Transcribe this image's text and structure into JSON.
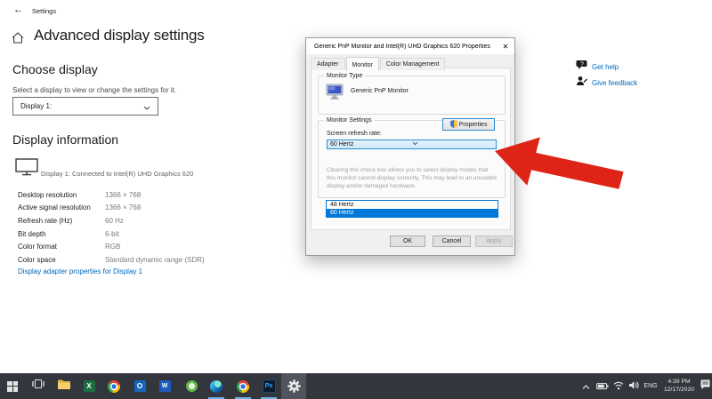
{
  "page": {
    "back_icon": "←",
    "app_title": "Settings",
    "title": "Advanced display settings",
    "choose": {
      "heading": "Choose display",
      "desc": "Select a display to view or change the settings for it.",
      "selected_display": "Display 1:"
    },
    "info": {
      "heading": "Display information",
      "connection": "Display 1: Connected to Intel(R) UHD Graphics 620",
      "rows": [
        {
          "label": "Desktop resolution",
          "value": "1366 × 768"
        },
        {
          "label": "Active signal resolution",
          "value": "1366 × 768"
        },
        {
          "label": "Refresh rate (Hz)",
          "value": "60 Hz"
        },
        {
          "label": "Bit depth",
          "value": "6-bit"
        },
        {
          "label": "Color format",
          "value": "RGB"
        },
        {
          "label": "Color space",
          "value": "Standard dynamic range (SDR)"
        }
      ],
      "adapter_link": "Display adapter properties for Display 1"
    },
    "help": {
      "get_help": "Get help",
      "give_feedback": "Give feedback"
    }
  },
  "dialog": {
    "title": "Generic PnP Monitor and Intel(R) UHD Graphics 620 Properties",
    "close": "✕",
    "tabs": [
      {
        "label": "Adapter"
      },
      {
        "label": "Monitor"
      },
      {
        "label": "Color Management"
      }
    ],
    "monitor_type": {
      "legend": "Monitor Type",
      "name": "Generic PnP Monitor",
      "properties": "Properties"
    },
    "monitor_settings": {
      "legend": "Monitor Settings",
      "label": "Screen refresh rate:",
      "value": "60 Hertz",
      "options": [
        {
          "label": "48 Hertz"
        },
        {
          "label": "60 Hertz"
        }
      ],
      "warning": "Clearing this check box allows you to select display modes that this monitor cannot display correctly. This may lead to an unusable display and/or damaged hardware."
    },
    "buttons": {
      "ok": "OK",
      "cancel": "Cancel",
      "apply": "Apply"
    }
  },
  "taskbar": {
    "tray": {
      "lang": "ENG",
      "time": "4:39 PM",
      "date": "12/17/2020"
    }
  },
  "colors": {
    "accent": "#0067b8",
    "selection": "#0078d7",
    "arrow_red": "#dd2417",
    "taskbar_bg": "#33363c"
  }
}
